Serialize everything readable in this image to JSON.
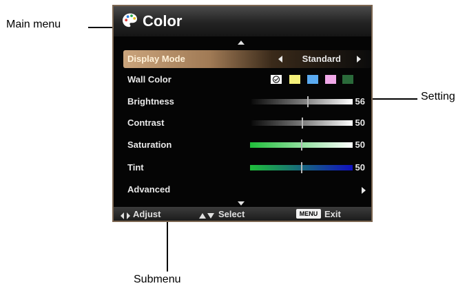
{
  "annotations": {
    "main_menu": "Main menu",
    "setting": "Setting",
    "submenu": "Submenu"
  },
  "osd": {
    "title": "Color",
    "title_icon": "palette-icon",
    "rows": [
      {
        "label": "Display Mode",
        "value": "Standard",
        "selected": true
      },
      {
        "label": "Wall Color",
        "swatches": [
          "#f4f07a",
          "#5aaaf0",
          "#f0a8e8",
          "#2a6a3a"
        ]
      },
      {
        "label": "Brightness",
        "value": "56",
        "level": 0.56
      },
      {
        "label": "Contrast",
        "value": "50",
        "level": 0.5
      },
      {
        "label": "Saturation",
        "value": "50",
        "level": 0.5
      },
      {
        "label": "Tint",
        "value": "50",
        "level": 0.5
      },
      {
        "label": "Advanced"
      }
    ],
    "footer": {
      "adjust": "Adjust",
      "select": "Select",
      "menu_key": "MENU",
      "exit": "Exit"
    }
  },
  "colors": {
    "highlight": "#caa47c",
    "frame": "#7c6650",
    "saturation_gradient": [
      "#1fbf3a",
      "#ffffff"
    ],
    "tint_gradient": [
      "#1fbf3a",
      "#1010c0"
    ]
  }
}
